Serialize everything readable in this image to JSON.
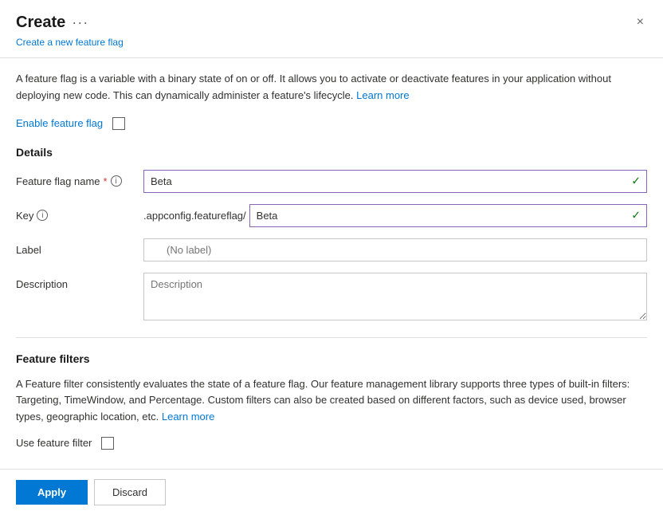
{
  "panel": {
    "title": "Create",
    "subtitle": "Create a new feature flag",
    "close_label": "×",
    "dots_label": "···"
  },
  "description": {
    "text_before_link": "A feature flag is a variable with a binary state of on or off. It allows you to activate or deactivate features in your application without deploying new code. This can dynamically administer a feature's lifecycle.",
    "link_text": "Learn more",
    "link_url": "#"
  },
  "enable": {
    "label": "Enable feature flag"
  },
  "details": {
    "section_title": "Details",
    "feature_flag_name": {
      "label": "Feature flag name",
      "required": "*",
      "value": "Beta",
      "info_title": "Feature flag name info"
    },
    "key": {
      "label": "Key",
      "prefix": ".appconfig.featureflag/",
      "value": "Beta",
      "info_title": "Key info"
    },
    "label_field": {
      "label": "Label",
      "placeholder": "(No label)"
    },
    "description_field": {
      "label": "Description",
      "placeholder": "Description"
    }
  },
  "feature_filters": {
    "section_title": "Feature filters",
    "description": "A Feature filter consistently evaluates the state of a feature flag. Our feature management library supports three types of built-in filters: Targeting, TimeWindow, and Percentage. Custom filters can also be created based on different factors, such as device used, browser types, geographic location, etc.",
    "learn_more_text": "Learn more",
    "use_filter_label": "Use feature filter"
  },
  "footer": {
    "apply_label": "Apply",
    "discard_label": "Discard"
  }
}
